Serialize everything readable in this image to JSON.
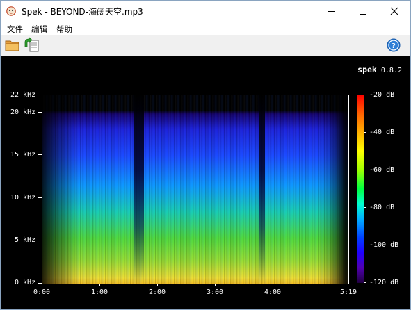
{
  "window": {
    "title": "Spek - BEYOND-海阔天空.mp3",
    "app_icon": "spek-icon",
    "controls": [
      "minimize-icon",
      "maximize-icon",
      "close-icon"
    ]
  },
  "menu": {
    "items": [
      "文件",
      "编辑",
      "帮助"
    ]
  },
  "toolbar": {
    "icons": [
      "open-folder-icon",
      "save-export-icon",
      "help-icon"
    ]
  },
  "brand": {
    "name": "spek",
    "version": "0.8.2"
  },
  "spectrogram": {
    "y_axis_labels": [
      "22 kHz",
      "20 kHz",
      "15 kHz",
      "10 kHz",
      "5 kHz",
      "0 kHz"
    ],
    "y_axis_values_khz": [
      22,
      20,
      15,
      10,
      5,
      0
    ],
    "x_axis_labels": [
      "0:00",
      "1:00",
      "2:00",
      "3:00",
      "4:00",
      "5:19"
    ],
    "x_axis_values_sec": [
      0,
      60,
      120,
      180,
      240,
      319
    ],
    "colorbar_labels": [
      "-20 dB",
      "-40 dB",
      "-60 dB",
      "-80 dB",
      "-100 dB",
      "-120 dB"
    ],
    "colorbar_values_db": [
      -20,
      -40,
      -60,
      -80,
      -100,
      -120
    ],
    "background_color": "#000000"
  }
}
